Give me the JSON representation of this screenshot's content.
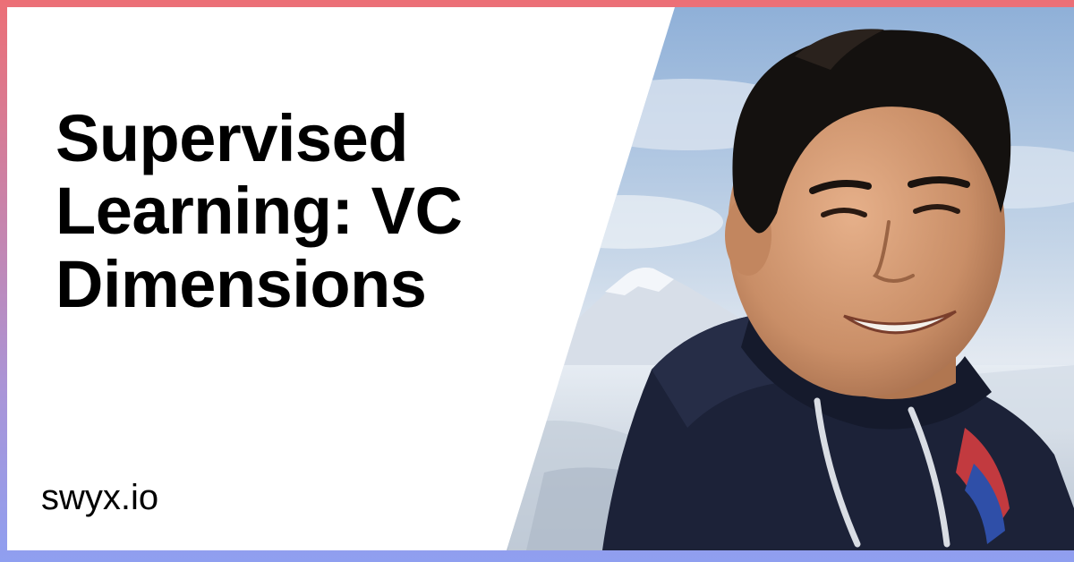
{
  "card": {
    "title": "Supervised Learning: VC Dimensions",
    "site": "swyx.io"
  },
  "colors": {
    "border_top": "#ec6f76",
    "border_bottom": "#8f9ff0",
    "background": "#ffffff",
    "text": "#000000"
  }
}
